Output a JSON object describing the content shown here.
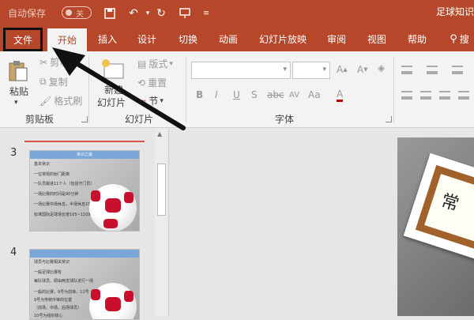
{
  "titlebar": {
    "autosave": "自动保存",
    "toggle": "关",
    "doc_title": "足球知识"
  },
  "tabs": [
    "文件",
    "开始",
    "插入",
    "设计",
    "切换",
    "动画",
    "幻灯片放映",
    "审阅",
    "视图",
    "帮助",
    "搜"
  ],
  "ribbon": {
    "paste": "粘贴",
    "cut": "剪切",
    "copy": "复制",
    "format_painter": "格式刷",
    "new_slide_1": "新建",
    "new_slide_2": "幻灯片",
    "layout": "版式",
    "reset": "重置",
    "section": "节",
    "groups": {
      "clipboard": "剪贴板",
      "slides": "幻灯片",
      "font": "字体"
    },
    "font_buttons": [
      "B",
      "I",
      "U",
      "S",
      "abc",
      "AV",
      "Aa",
      "A"
    ]
  },
  "thumbs": [
    {
      "num": "3",
      "header": "常识之最",
      "lines": [
        "基本常识",
        "一位常规的射门距离",
        "一队员踢进11个人（包括守门员）",
        "一场比赛的时间是90分钟",
        "一场比赛中场休息，半场休息15分钟",
        "标准国际足球场长度105~110米，宽度68~75米"
      ]
    },
    {
      "num": "4",
      "header": "",
      "lines": [
        "球员与比赛相关常识",
        "一般足球比赛有",
        "每队球员，即由两支球队进行一场",
        "一般的比赛，9号为前锋，11号",
        "9号为传统中锋的位置",
        "（前场，中场，后场球员）",
        "10号为组织核心"
      ]
    }
  ],
  "slide_text": "常"
}
